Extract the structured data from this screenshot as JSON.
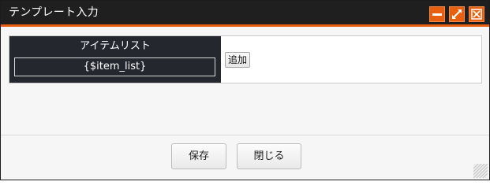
{
  "window": {
    "title": "テンプレート入力",
    "accent_color": "#e8600f",
    "titlebar_color": "#1f1f1f",
    "controls": {
      "minimize_icon": "minimize-icon",
      "maximize_icon": "expand-arrows-icon",
      "close_icon": "close-x-icon"
    }
  },
  "form": {
    "row_label": "アイテムリスト",
    "variable_value": "{$item_list}",
    "add_label": "追加"
  },
  "footer": {
    "save_label": "保存",
    "close_label": "閉じる"
  }
}
